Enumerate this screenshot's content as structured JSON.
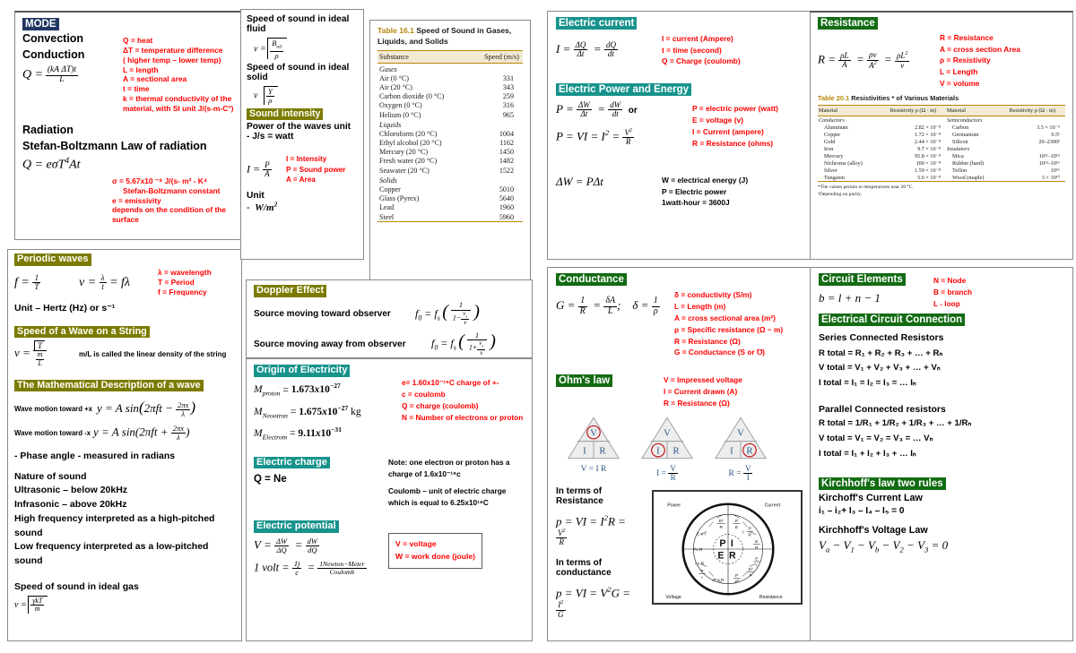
{
  "mode": {
    "heading": "MODE",
    "items": [
      "Convection",
      "Conduction"
    ],
    "formula_q": "Q = (kA ΔT)t / L",
    "legend": [
      "Q  = heat",
      "ΔT = temperature difference",
      "( higher temp – lower temp)",
      "L = length",
      "A = sectional area",
      "t = time",
      "k = thermal conductivity of the",
      "material, with SI unit J/(s-m-C°)"
    ],
    "radiation_title": "Radiation",
    "stefan_title": "Stefan-Boltzmann Law of radiation",
    "formula_rad": "Q = eσT⁴At",
    "legend2": [
      "σ = 5.67x10 ⁻⁸ J/(s- m² - K⁴",
      "Stefan-Boltzmann constant",
      "e = emissivity",
      "depends on the condition of the",
      "surface"
    ]
  },
  "waves": {
    "periodic_heading": "Periodic waves",
    "f_formula": "f = 1/T",
    "v_formula": "v = λ/t = fλ",
    "legend": [
      "λ = wavelength",
      "T = Period",
      "f = Frequency"
    ],
    "unit_line": "Unit – Hertz (Hz) or s⁻¹",
    "string_heading": "Speed of a Wave on a String",
    "string_formula": "v = √T / (m/L)",
    "string_note": "m/L is called the linear density of the string",
    "math_heading": "The Mathematical Description of a wave",
    "wave_plus_label": "Wave motion toward +x",
    "wave_plus_formula": "y = A sin(2πft − 2πx/λ)",
    "wave_minus_label": "Wave motion toward -x",
    "wave_minus_formula": "y = A sin(2πft + 2πx/λ)",
    "phase_line": "-  Phase angle     - measured in radians",
    "nature_title": "Nature of sound",
    "nature_lines": [
      "Ultrasonic – below 20kHz",
      "Infrasonic – above 20kHz",
      "High frequency interpreted as a high-pitched sound",
      "Low frequency interpreted as a low-pitched sound"
    ],
    "ideal_gas_title": "Speed of sound in ideal gas",
    "ideal_gas_formula": "v = √(γkT/m)"
  },
  "sound": {
    "fluid_title": "Speed of sound in ideal fluid",
    "fluid_formula": "v = √(B_ad / ρ)",
    "solid_title": "Speed of sound in ideal solid",
    "solid_formula": "v = √(Y / ρ)",
    "intensity_heading": "Sound intensity",
    "power_title": "Power of the waves unit",
    "power_line": "-   J/s  = watt",
    "intensity_formula": "I = P/A",
    "legend": [
      "I = Intensity",
      "P = Sound power",
      "A = Area"
    ],
    "unit_title": "Unit",
    "unit_line": "-  W/m²"
  },
  "table161": {
    "number": "Table 16.1",
    "title": "Speed of Sound in Gases, Liquids, and Solids",
    "columns": [
      "Substance",
      "Speed (m/s)"
    ],
    "rows": [
      {
        "group": "Gases"
      },
      {
        "substance": "Air (0 °C)",
        "speed": "331"
      },
      {
        "substance": "Air (20 °C)",
        "speed": "343"
      },
      {
        "substance": "Carbon dioxide (0 °C)",
        "speed": "259"
      },
      {
        "substance": "Oxygen (0 °C)",
        "speed": "316"
      },
      {
        "substance": "Helium (0 °C)",
        "speed": "965"
      },
      {
        "group": "Liquids"
      },
      {
        "substance": "Chloroform (20 °C)",
        "speed": "1004"
      },
      {
        "substance": "Ethyl alcohol (20 °C)",
        "speed": "1162"
      },
      {
        "substance": "Mercury (20 °C)",
        "speed": "1450"
      },
      {
        "substance": "Fresh water (20 °C)",
        "speed": "1482"
      },
      {
        "substance": "Seawater (20 °C)",
        "speed": "1522"
      },
      {
        "group": "Solids"
      },
      {
        "substance": "Copper",
        "speed": "5010"
      },
      {
        "substance": "Glass (Pyrex)",
        "speed": "5640"
      },
      {
        "substance": "Lead",
        "speed": "1960"
      },
      {
        "substance": "Steel",
        "speed": "5960"
      }
    ]
  },
  "doppler": {
    "heading": "Doppler Effect",
    "toward_label": "Source moving toward observer",
    "toward_formula": "f₀ = f_s ( 1 / (1 − v_s/v) )",
    "away_label": "Source moving away from observer",
    "away_formula": "f₀ = f_s ( 1 / (1 + v_s/v) )"
  },
  "origin": {
    "heading": "Origin of Electricity",
    "m_proton": "M_proton = 1.673x10⁻²⁷",
    "m_neutron": "M_Neootron = 1.675x10⁻²⁷ kg",
    "m_electron": "M_Electrom = 9.11x10⁻³¹",
    "legend": [
      "e= 1.60x10⁻¹⁹C  charge of +-",
      "c = coulomb",
      "Q = charge (coulomb)",
      "N = Number of electrons or proton"
    ],
    "charge_heading": "Electric charge",
    "charge_formula": "Q = Ne",
    "charge_note1": "Note: one electron or proton has a",
    "charge_note1b": "charge of 1.6x10⁻¹⁹c",
    "charge_note2": "Coulomb – unit of electric charge",
    "charge_note2b": "which is equal to 6.25x10¹⁸C",
    "potential_heading": "Electric potential",
    "potential_formula": "V = ΔW/ΔQ = dW/dQ",
    "volt_formula": "1 volt = 1j/c = 1Newton−Meter / Coulomb",
    "box_legend": [
      "V = voltage",
      "W = work done (joule)"
    ]
  },
  "current": {
    "heading": "Electric current",
    "formula": "I = ΔQ/Δt = dQ/dt",
    "legend": [
      "I = current (Ampere)",
      "t = time (second)",
      "Q = Charge (coulomb)"
    ],
    "power_heading": "Electric Power and Energy",
    "power_formula1": "P = ΔW/Δt = dW/dt",
    "power_or": "or",
    "power_formula2": "P = VI = I² = V²/R",
    "power_legend": [
      "P = electric power (watt)",
      "E = voltage (v)",
      "I = Current (ampere)",
      "R = Resistance (ohms)"
    ],
    "energy_formula": "ΔW = PΔt",
    "energy_legend": [
      "W = electrical energy (J)",
      "P = Electric power",
      "1watt-hour = 3600J"
    ]
  },
  "resistance": {
    "heading": "Resistance",
    "formula": "R = ρL/A = ρv/A² = ρL²/v",
    "legend": [
      "R = Resistance",
      "A = cross section Area",
      "ρ = Resistivity",
      "L = Length",
      "V = volume"
    ],
    "table": {
      "number": "Table 20.1",
      "title": "Resistivities * of Various Materials",
      "columns": [
        "Material",
        "Resistivity ρ (Ω · m)",
        "Material",
        "Resistivity ρ (Ω · m)"
      ],
      "left": [
        {
          "group": "Conductors"
        },
        {
          "material": "Aluminum",
          "value": "2.82 × 10⁻⁸"
        },
        {
          "material": "Copper",
          "value": "1.72 × 10⁻⁸"
        },
        {
          "material": "Gold",
          "value": "2.44 × 10⁻⁸"
        },
        {
          "material": "Iron",
          "value": "9.7 × 10⁻⁸"
        },
        {
          "material": "Mercury",
          "value": "95.8 × 10⁻⁸"
        },
        {
          "material": "Nichrome (alloy)",
          "value": "100 × 10⁻⁸"
        },
        {
          "material": "Silver",
          "value": "1.59 × 10⁻⁸"
        },
        {
          "material": "Tungsten",
          "value": "5.6 × 10⁻⁸"
        }
      ],
      "right": [
        {
          "group": "Semiconductors"
        },
        {
          "material": "Carbon",
          "value": "3.5 × 10⁻⁵"
        },
        {
          "material": "Germanium",
          "value": "0.5ᵇ"
        },
        {
          "material": "Silicon",
          "value": "20–2300ᵇ"
        },
        {
          "group": "Insulators"
        },
        {
          "material": "Mica",
          "value": "10¹¹–10¹⁵"
        },
        {
          "material": "Rubber (hard)",
          "value": "10¹³–10¹⁶"
        },
        {
          "material": "Teflon",
          "value": "10¹⁶"
        },
        {
          "material": "Wood (maple)",
          "value": "3 × 10¹⁰"
        }
      ],
      "footnotes": [
        "*The values pertain to temperatures near 20 °C.",
        "ᵇDepending on purity."
      ]
    }
  },
  "conductance": {
    "heading": "Conductance",
    "formula": "G = 1/R = δA/L;      δ = 1/ρ",
    "legend": [
      "δ = conductivity (S/m)",
      "L = Length (m)",
      "A = cross sectional area (m²)",
      "ρ = Specific resistance (Ω − m)",
      "R = Resistance (Ω)",
      "G = Conductance (S or ℧)"
    ],
    "ohm_heading": "Ohm's law",
    "ohm_legend": [
      "V = Impressed voltage",
      "I = Current drawn (A)",
      "R = Resistance (Ω)"
    ],
    "triangles": [
      {
        "top": "V",
        "left": "I",
        "right": "R",
        "circled": "V",
        "caption": "V = I R"
      },
      {
        "top": "V",
        "left": "I",
        "right": "R",
        "circled": "I",
        "caption": "I = V / R"
      },
      {
        "top": "V",
        "left": "I",
        "right": "R",
        "circled": "R",
        "caption": "R = V / I"
      }
    ],
    "res_title": "In terms of Resistance",
    "res_formula": "p = VI = I²R = V²/R",
    "cond_title": "In terms of conductance",
    "cond_formula": "p = VI = V²G = I²/G",
    "wheel": {
      "quadrants": [
        "Power",
        "Current",
        "Resistance",
        "Voltage"
      ],
      "center": [
        "P",
        "I",
        "E",
        "R"
      ],
      "segments": [
        "E²/R",
        "P/E",
        "√(P/R)",
        "E/R",
        "E/I",
        "E²/P",
        "P/I²",
        "√(P x R)",
        "P/I",
        "I x R",
        "I²x R",
        "E x I"
      ]
    }
  },
  "circuit": {
    "heading": "Circuit Elements",
    "formula": "b = l + n − 1",
    "legend": [
      "N = Node",
      "B = branch",
      "L - loop"
    ],
    "connection_heading": "Electrical Circuit Connection",
    "series_title": "Series Connected Resistors",
    "series_lines": [
      "R total = R₁ + R₂ + R₃ + … + Rₙ",
      "V total = V₁ + V₂ + V₃ + … + Vₙ",
      "I total = I₁ = I₂ = I₃ = … Iₙ"
    ],
    "parallel_title": "Parallel Connected resistors",
    "parallel_lines": [
      "R total = 1/R₁ + 1/R₂ + 1/R₃ + … + 1/Rₙ",
      "V total = V₁ = V₂ = V₃ = … Vₙ",
      "I total = I₁ + I₂ + I₃ + … Iₙ"
    ],
    "kirchhoff_heading": "Kirchhoff's law two rules",
    "kcl_title": "Kirchoff's Current Law",
    "kcl_formula": "i₁ – i₂+ I₃ – I₄ – I₅ = 0",
    "kvl_title": "Kirchhoff's Voltage Law",
    "kvl_formula": "V_a − V₁ − V_b − V₂ − V₃ = 0"
  }
}
